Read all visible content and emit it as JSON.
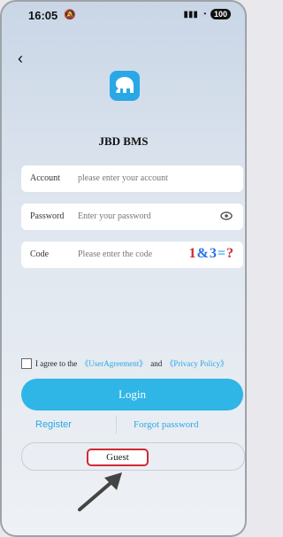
{
  "status": {
    "time": "16:05",
    "battery": "100"
  },
  "app": {
    "title": "JBD BMS"
  },
  "form": {
    "account": {
      "label": "Account",
      "placeholder": "please enter your account"
    },
    "password": {
      "label": "Password",
      "placeholder": "Enter your password"
    },
    "code": {
      "label": "Code",
      "placeholder": "Please enter the code",
      "captcha": "1&3=?"
    },
    "agree": {
      "prefix": "I agree to the",
      "user_agreement": "《UserAgreement》",
      "and": "and",
      "privacy": "《Privacy Policy》"
    },
    "login_label": "Login",
    "register_label": "Register",
    "forgot_label": "Forgot password",
    "guest_label": "Guest"
  },
  "colors": {
    "accent": "#2fb5e6",
    "highlight": "#d02a35"
  }
}
